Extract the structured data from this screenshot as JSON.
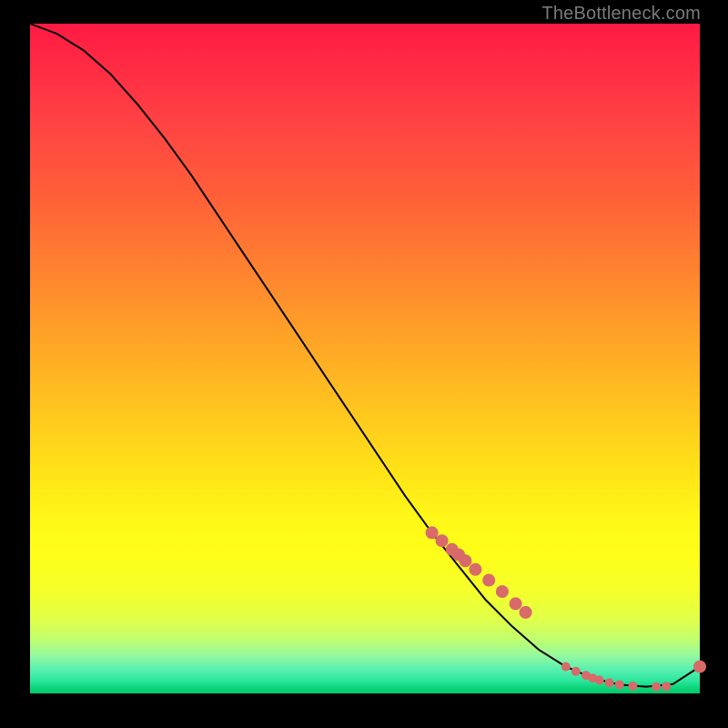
{
  "watermark": "TheBottleneck.com",
  "chart_data": {
    "type": "line",
    "title": "",
    "xlabel": "",
    "ylabel": "",
    "xlim": [
      0,
      100
    ],
    "ylim": [
      0,
      100
    ],
    "grid": false,
    "legend": false,
    "series": [
      {
        "name": "bottleneck-curve",
        "x": [
          0,
          4,
          8,
          12,
          16,
          20,
          24,
          28,
          32,
          36,
          40,
          44,
          48,
          52,
          56,
          60,
          64,
          68,
          72,
          76,
          80,
          84,
          88,
          92,
          96,
          100
        ],
        "y": [
          100,
          98.5,
          96,
          92.5,
          88,
          83,
          77.5,
          71.5,
          65.5,
          59.5,
          53.5,
          47.5,
          41.5,
          35.5,
          29.5,
          24,
          19,
          14,
          10,
          6.5,
          4,
          2.3,
          1.3,
          1.0,
          1.4,
          4.0
        ]
      }
    ],
    "markers": {
      "name": "highlight-points",
      "color": "#d86a6a",
      "radius_major": 7,
      "radius_minor": 5,
      "x": [
        60,
        61.5,
        63,
        64,
        65,
        66.5,
        68.5,
        70.5,
        72.5,
        74,
        80,
        81.5,
        83,
        84,
        85,
        86.5,
        88,
        90,
        93.5,
        95,
        100
      ],
      "y": [
        24,
        22.8,
        21.5,
        20.7,
        19.8,
        18.5,
        16.9,
        15.2,
        13.4,
        12.1,
        4,
        3.3,
        2.7,
        2.3,
        2.0,
        1.6,
        1.3,
        1.1,
        1.0,
        1.05,
        4.0
      ],
      "major_idx": [
        0,
        1,
        2,
        3,
        4,
        5,
        6,
        7,
        8,
        9,
        20
      ]
    }
  }
}
